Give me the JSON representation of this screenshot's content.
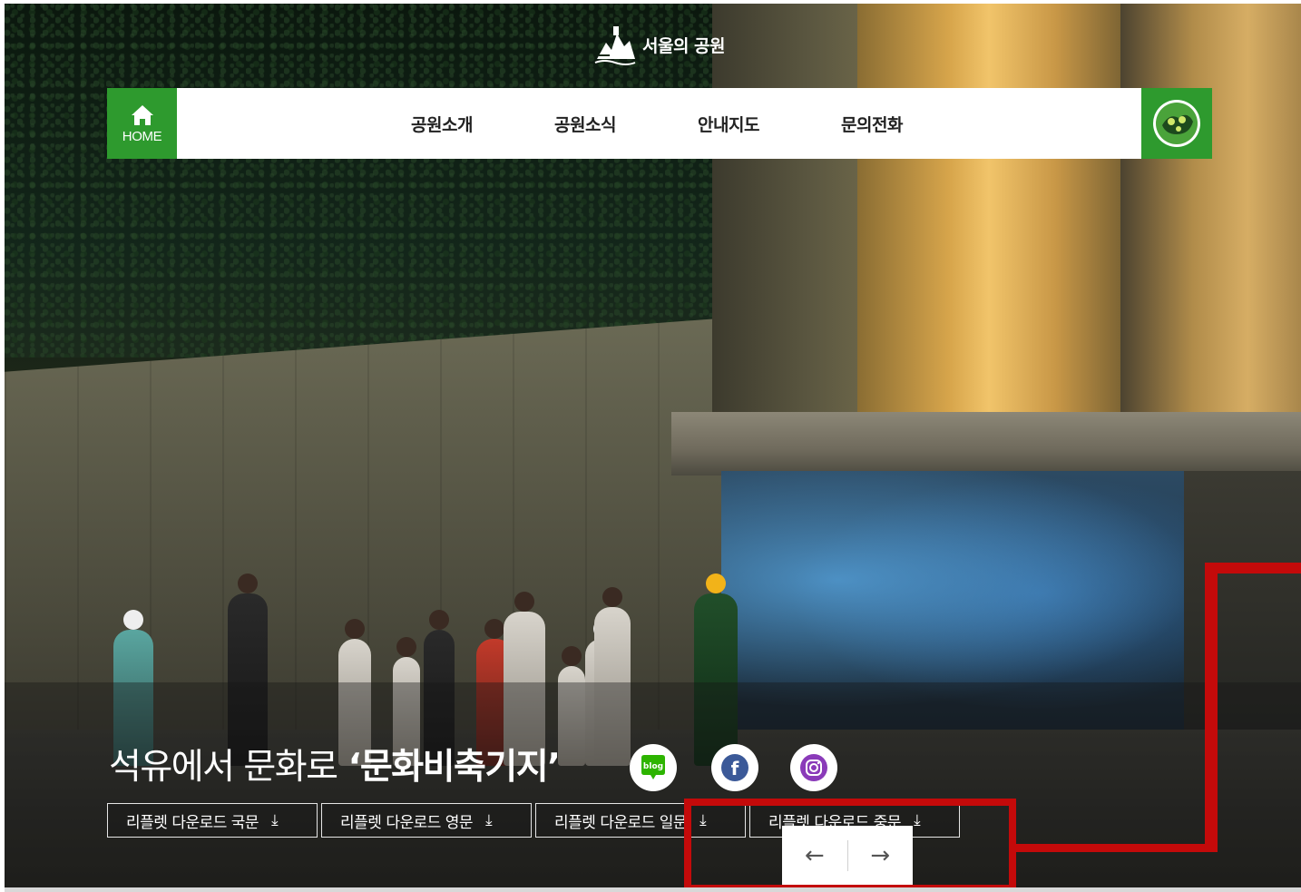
{
  "logo": {
    "text": "서울의 공원",
    "icon": "park-mountain-logo-icon"
  },
  "nav": {
    "home_label": "HOME",
    "home_icon": "home-icon",
    "items": [
      {
        "label": "공원소개"
      },
      {
        "label": "공원소식"
      },
      {
        "label": "안내지도"
      },
      {
        "label": "문의전화"
      }
    ],
    "emblem_icon": "park-emblem-icon"
  },
  "hero": {
    "headline_light": "석유에서 문화로",
    "headline_bold": "‘문화비축기지’",
    "social": [
      {
        "name": "blog",
        "icon": "blog-icon",
        "label": "blog",
        "color": "#2db400"
      },
      {
        "name": "facebook",
        "icon": "facebook-icon",
        "label": "f",
        "color": "#3b5998"
      },
      {
        "name": "instagram",
        "icon": "instagram-icon",
        "color": "#8a3ab9"
      }
    ]
  },
  "downloads": [
    {
      "label": "리플렛 다운로드 국문",
      "icon": "download-arrow-icon"
    },
    {
      "label": "리플렛 다운로드 영문",
      "icon": "download-arrow-icon"
    },
    {
      "label": "리플렛 다운로드 일문",
      "icon": "download-arrow-icon"
    },
    {
      "label": "리플렛 다운로드 중문",
      "icon": "download-arrow-icon"
    }
  ],
  "slider": {
    "prev_icon": "arrow-left-icon",
    "next_icon": "arrow-right-icon",
    "prev_glyph": "←",
    "next_glyph": "→"
  },
  "colors": {
    "brand_green": "#2e9a2e",
    "highlight_red": "#c40a0a"
  }
}
